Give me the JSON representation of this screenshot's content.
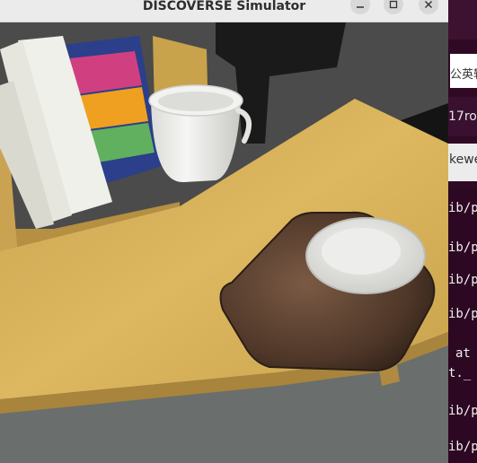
{
  "window": {
    "title": "DISCOVERSE Simulator",
    "buttons": {
      "minimize": "−",
      "maximize": "☐",
      "close": "✕"
    }
  },
  "side_panel": {
    "search_text": "公英辑",
    "tab_label": "17ro",
    "tab2_label": "kewe",
    "terminal_lines": [
      "ib/p",
      "ib/p",
      "ib/p",
      "ib/p",
      "ib/p",
      "at",
      "t._",
      "ib/p",
      "ib/p"
    ]
  },
  "colors": {
    "table": "#d8b25a",
    "wall": "#4a4a4a",
    "tray": "#5a4030",
    "titlebar": "#ebebeb",
    "terminal_bg": "#2c0822"
  }
}
